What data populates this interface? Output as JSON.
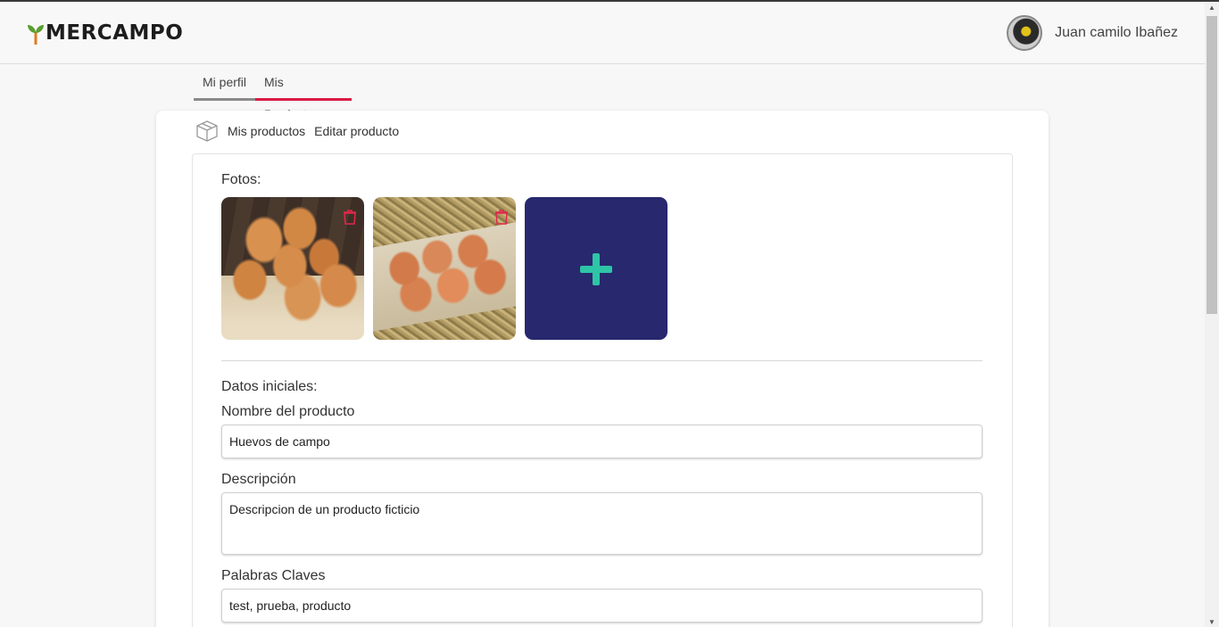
{
  "header": {
    "logo_text": "MERCAMPO",
    "user_name": "Juan camilo Ibañez"
  },
  "tabs": [
    {
      "label": "Mi perfil",
      "active": false
    },
    {
      "label": "Mis Productos",
      "active": true
    }
  ],
  "breadcrumb": {
    "icon": "box-icon",
    "items": [
      "Mis productos",
      "Editar producto"
    ]
  },
  "photos_section": {
    "label": "Fotos:",
    "photos": [
      {
        "subject": "eggs-in-basket",
        "delete_icon": "trash-icon"
      },
      {
        "subject": "eggs-in-carton",
        "delete_icon": "trash-icon"
      }
    ],
    "add_icon": "plus-icon"
  },
  "form": {
    "section_label": "Datos iniciales:",
    "name": {
      "label": "Nombre del producto",
      "value": "Huevos de campo"
    },
    "description": {
      "label": "Descripción",
      "value": "Descripcion de un producto ficticio"
    },
    "keywords": {
      "label": "Palabras Claves",
      "value": "test, prueba, producto"
    }
  },
  "colors": {
    "accent": "#d81b45",
    "add_photo_bg": "#28286e",
    "plus": "#2ec4a6",
    "logo_leaf": "#5a9e2f"
  }
}
